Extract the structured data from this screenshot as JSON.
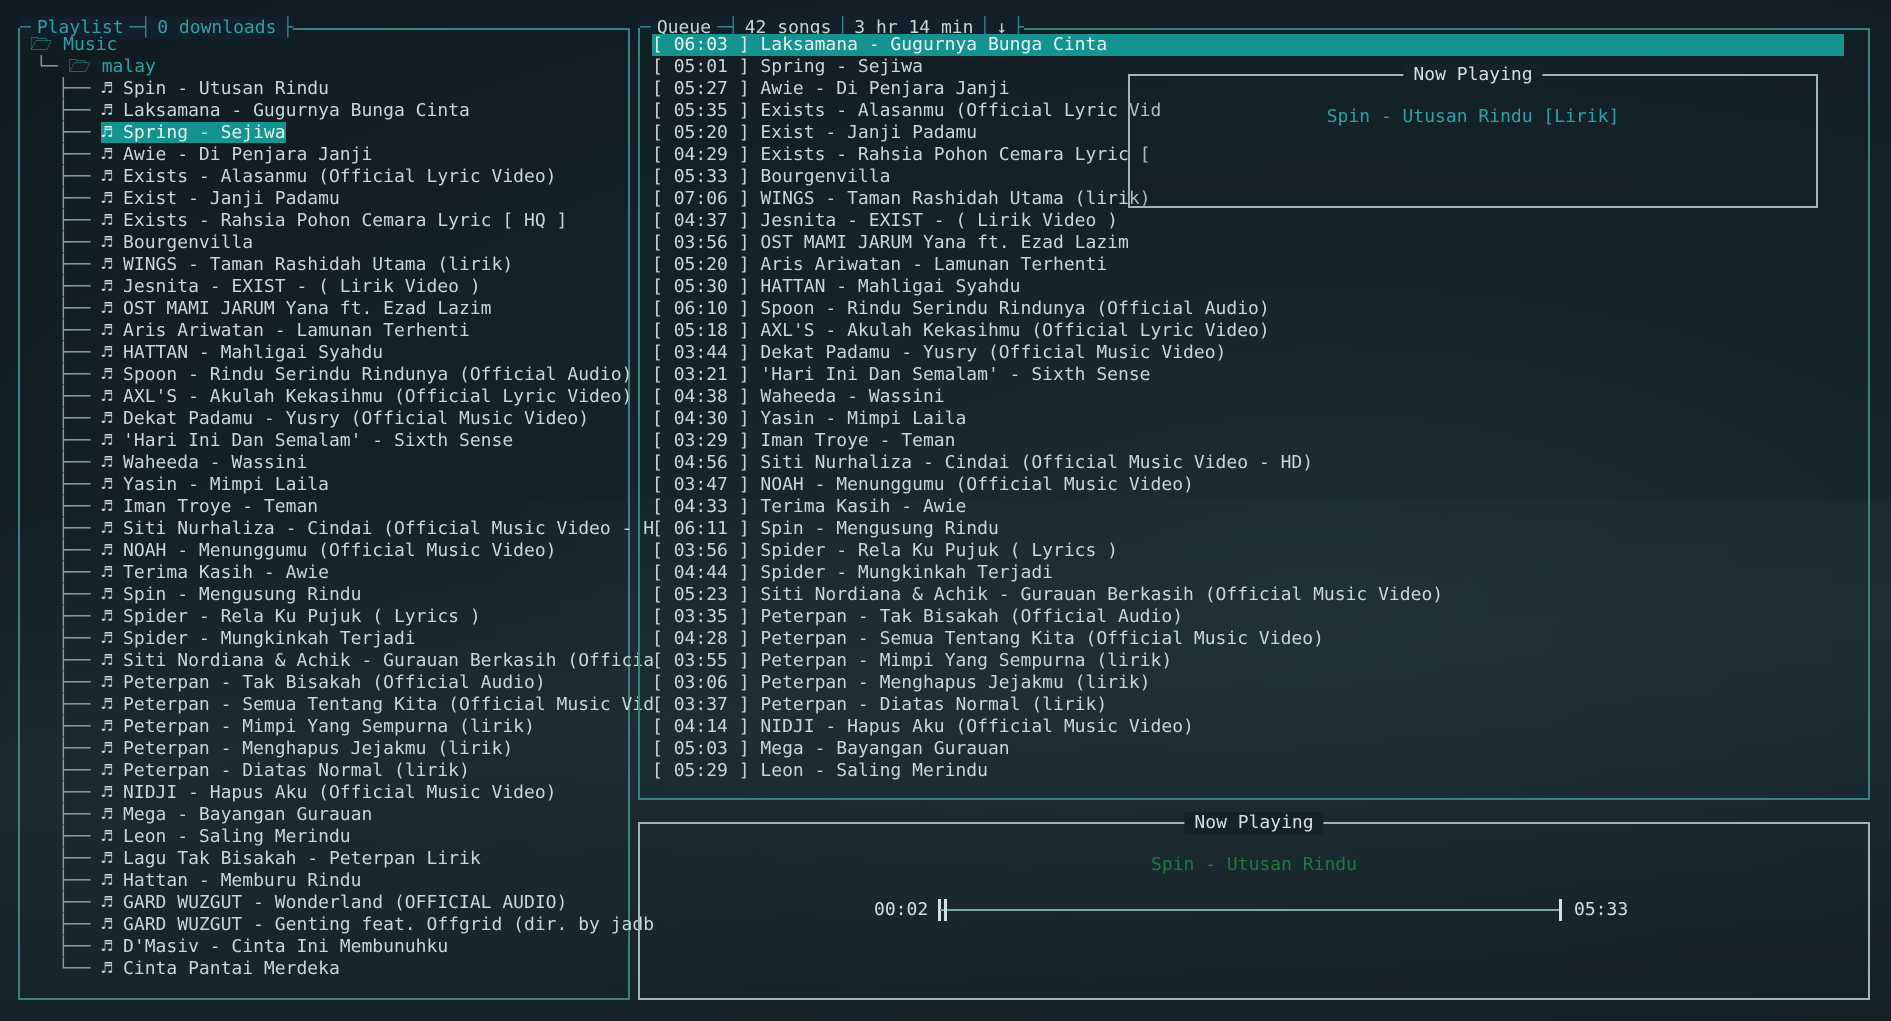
{
  "playlist": {
    "title": "Playlist",
    "downloads": "0 downloads",
    "root": "Music",
    "folder": "malay",
    "selected_index": 2,
    "items": [
      "Spin - Utusan Rindu",
      "Laksamana - Gugurnya Bunga Cinta",
      "Spring - Sejiwa",
      "Awie - Di Penjara Janji",
      "Exists - Alasanmu (Official Lyric Video)",
      "Exist - Janji Padamu",
      "Exists - Rahsia Pohon Cemara Lyric [ HQ ]",
      "Bourgenvilla",
      "WINGS - Taman Rashidah Utama (lirik)",
      "Jesnita - EXIST - ( Lirik Video )",
      "OST MAMI JARUM Yana ft. Ezad Lazim",
      "Aris Ariwatan - Lamunan Terhenti",
      "HATTAN - Mahligai Syahdu",
      "Spoon - Rindu Serindu Rindunya (Official Audio)",
      "AXL'S - Akulah Kekasihmu (Official Lyric Video)",
      "Dekat Padamu - Yusry (Official Music Video)",
      "'Hari Ini Dan Semalam' - Sixth Sense",
      "Waheeda - Wassini",
      "Yasin - Mimpi Laila",
      "Iman Troye - Teman",
      "Siti Nurhaliza - Cindai (Official Music Video - H",
      "NOAH - Menunggumu (Official Music Video)",
      "Terima Kasih - Awie",
      "Spin - Mengusung Rindu",
      "Spider - Rela Ku Pujuk ( Lyrics )",
      "Spider - Mungkinkah Terjadi",
      "Siti Nordiana & Achik - Gurauan Berkasih (Officia",
      "Peterpan - Tak Bisakah (Official Audio)",
      "Peterpan - Semua Tentang Kita (Official Music Vid",
      "Peterpan - Mimpi Yang Sempurna (lirik)",
      "Peterpan - Menghapus Jejakmu (lirik)",
      "Peterpan - Diatas Normal (lirik)",
      "NIDJI - Hapus Aku (Official Music Video)",
      "Mega - Bayangan Gurauan",
      "Leon - Saling Merindu",
      "Lagu Tak Bisakah - Peterpan Lirik",
      "Hattan - Memburu Rindu",
      "GARD WUZGUT - Wonderland (OFFICIAL AUDIO)",
      "GARD WUZGUT - Genting feat. Offgrid (dir. by jadb",
      "D'Masiv - Cinta Ini Membunuhku",
      "Cinta Pantai Merdeka"
    ]
  },
  "queue": {
    "title": "Queue",
    "songs": "42 songs",
    "duration": "3 hr 14 min",
    "sort_icon": "↓",
    "selected_index": 0,
    "items": [
      {
        "time": "06:03",
        "title": "Laksamana - Gugurnya Bunga Cinta"
      },
      {
        "time": "05:01",
        "title": "Spring - Sejiwa"
      },
      {
        "time": "05:27",
        "title": "Awie - Di Penjara Janji"
      },
      {
        "time": "05:35",
        "title": "Exists - Alasanmu (Official Lyric Vid"
      },
      {
        "time": "05:20",
        "title": "Exist - Janji Padamu"
      },
      {
        "time": "04:29",
        "title": "Exists - Rahsia Pohon Cemara Lyric ["
      },
      {
        "time": "05:33",
        "title": "Bourgenvilla"
      },
      {
        "time": "07:06",
        "title": "WINGS - Taman Rashidah Utama (lirik)"
      },
      {
        "time": "04:37",
        "title": "Jesnita - EXIST - ( Lirik Video )"
      },
      {
        "time": "03:56",
        "title": "OST MAMI JARUM Yana ft. Ezad Lazim"
      },
      {
        "time": "05:20",
        "title": "Aris Ariwatan - Lamunan Terhenti"
      },
      {
        "time": "05:30",
        "title": "HATTAN - Mahligai Syahdu"
      },
      {
        "time": "06:10",
        "title": "Spoon - Rindu Serindu Rindunya (Official Audio)"
      },
      {
        "time": "05:18",
        "title": "AXL'S - Akulah Kekasihmu (Official Lyric Video)"
      },
      {
        "time": "03:44",
        "title": "Dekat Padamu - Yusry (Official Music Video)"
      },
      {
        "time": "03:21",
        "title": "'Hari Ini Dan Semalam' - Sixth Sense"
      },
      {
        "time": "04:38",
        "title": "Waheeda - Wassini"
      },
      {
        "time": "04:30",
        "title": "Yasin - Mimpi Laila"
      },
      {
        "time": "03:29",
        "title": "Iman Troye - Teman"
      },
      {
        "time": "04:56",
        "title": "Siti Nurhaliza - Cindai (Official Music Video - HD)"
      },
      {
        "time": "03:47",
        "title": "NOAH - Menunggumu (Official Music Video)"
      },
      {
        "time": "04:33",
        "title": "Terima Kasih - Awie"
      },
      {
        "time": "06:11",
        "title": "Spin - Mengusung Rindu"
      },
      {
        "time": "03:56",
        "title": "Spider - Rela Ku Pujuk ( Lyrics )"
      },
      {
        "time": "04:44",
        "title": "Spider - Mungkinkah Terjadi"
      },
      {
        "time": "05:23",
        "title": "Siti Nordiana & Achik - Gurauan Berkasih (Official Music Video)"
      },
      {
        "time": "03:35",
        "title": "Peterpan - Tak Bisakah (Official Audio)"
      },
      {
        "time": "04:28",
        "title": "Peterpan - Semua Tentang Kita (Official Music Video)"
      },
      {
        "time": "03:55",
        "title": "Peterpan - Mimpi Yang Sempurna (lirik)"
      },
      {
        "time": "03:06",
        "title": "Peterpan - Menghapus Jejakmu (lirik)"
      },
      {
        "time": "03:37",
        "title": "Peterpan - Diatas Normal (lirik)"
      },
      {
        "time": "04:14",
        "title": "NIDJI - Hapus Aku (Official Music Video)"
      },
      {
        "time": "05:03",
        "title": "Mega - Bayangan Gurauan"
      },
      {
        "time": "05:29",
        "title": "Leon - Saling Merindu"
      }
    ]
  },
  "popup": {
    "title": "Now Playing",
    "song": "Spin - Utusan Rindu [Lirik]"
  },
  "now_playing": {
    "title": "Now Playing",
    "song": "Spin - Utusan Rindu",
    "elapsed": "00:02",
    "total": "05:33",
    "progress_fraction": 0.006
  },
  "colors": {
    "accent": "#2aa3a7",
    "selection": "#14938f",
    "border": "#3a7f82",
    "now_playing_song": "#1f7a3a"
  }
}
